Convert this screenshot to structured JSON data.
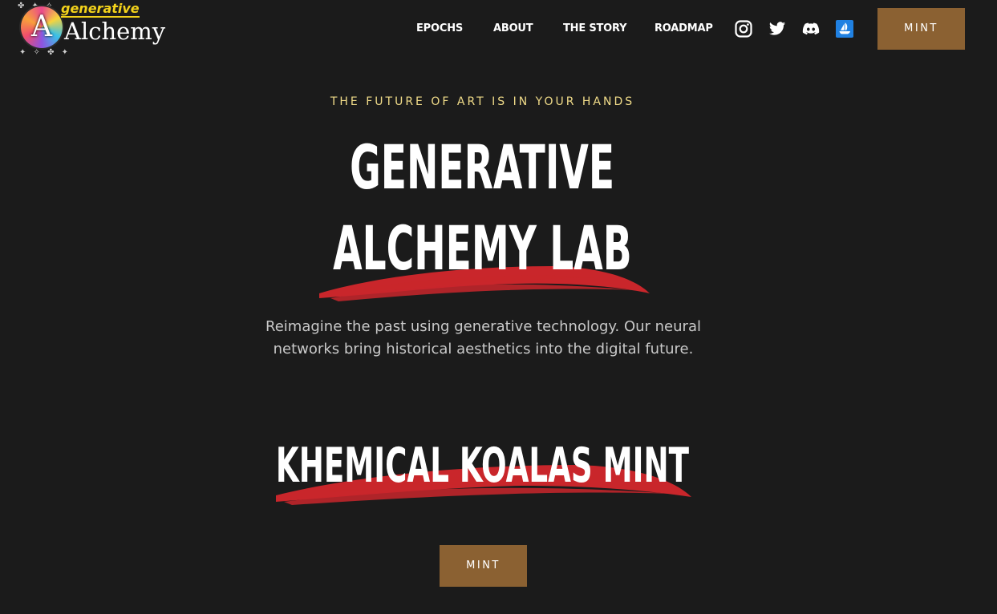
{
  "brand": {
    "logo_word_top": "generative",
    "logo_word_main": "Alchemy",
    "logo_glyph": "A"
  },
  "nav": {
    "items": [
      "EPOCHS",
      "ABOUT",
      "THE STORY",
      "ROADMAP"
    ]
  },
  "social": [
    {
      "icon": "instagram-icon"
    },
    {
      "icon": "twitter-icon"
    },
    {
      "icon": "discord-icon"
    },
    {
      "icon": "opensea-icon"
    }
  ],
  "header": {
    "mint_label": "MINT"
  },
  "hero": {
    "eyebrow": "THE FUTURE OF ART IS IN YOUR HANDS",
    "title_line1": "GENERATIVE",
    "title_line2": "ALCHEMY LAB",
    "description": "Reimagine the past using generative technology. Our neural networks bring historical aesthetics into the digital future."
  },
  "mint_section": {
    "title": "KHEMICAL KOALAS MINT",
    "button_label": "MINT"
  },
  "colors": {
    "background": "#1b1b1b",
    "accent_button": "#8b6132",
    "eyebrow": "#f1dc89",
    "brush": "#c9262b",
    "logo_yellow": "#f3d21b",
    "opensea_blue": "#2081e2"
  }
}
